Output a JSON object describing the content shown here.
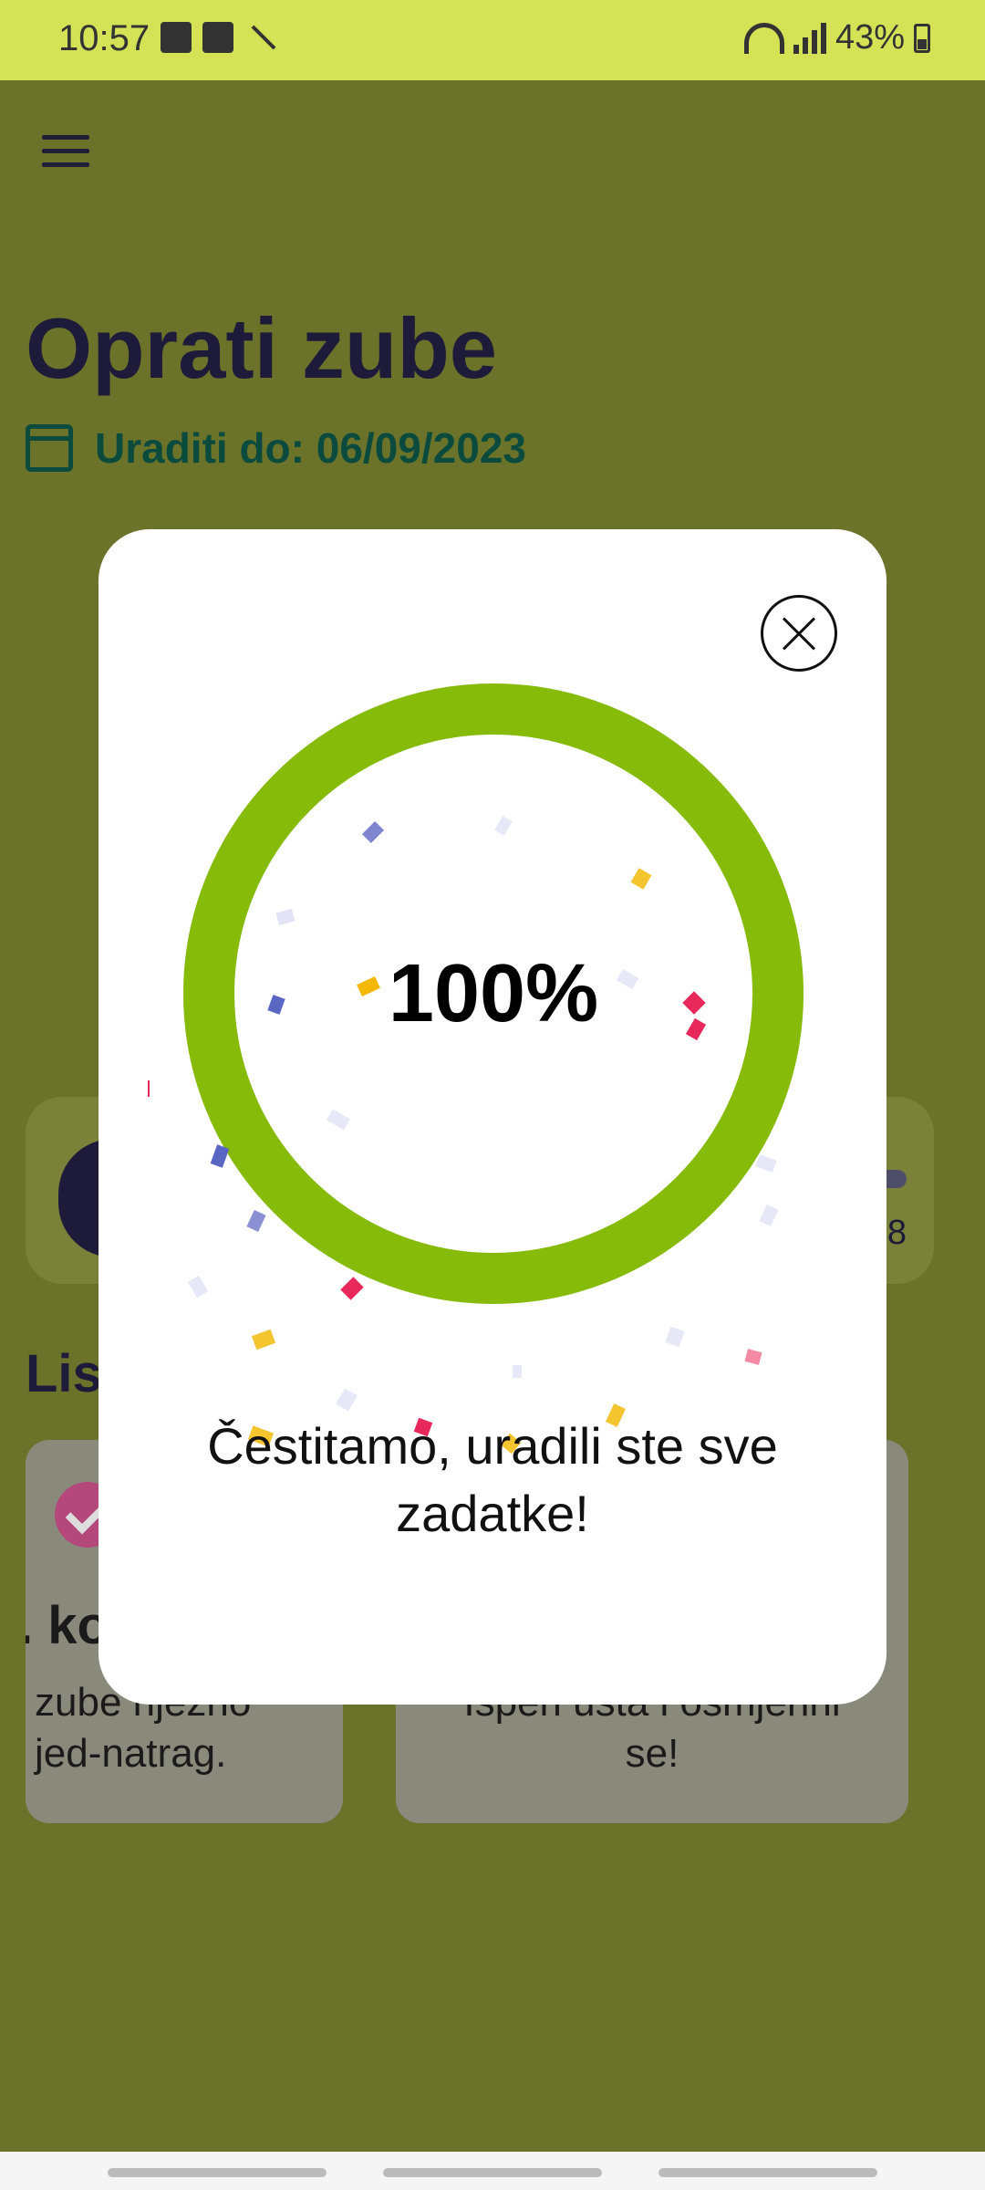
{
  "status_bar": {
    "time": "10:57",
    "battery_text": "43%",
    "icons": [
      "image-icon",
      "check-square-icon",
      "magic-wand-icon",
      "wifi-icon",
      "signal-icon",
      "battery-icon"
    ]
  },
  "header": {
    "menu_icon": "hamburger-menu-icon"
  },
  "task": {
    "title": "Oprati zube",
    "due_label": "Uraditi do: 06/09/2023"
  },
  "background": {
    "progress_count_fragment": "8",
    "list_heading_fragment": "Lis",
    "steps": [
      {
        "title_fragment": ". ko",
        "description": "zube njezno\njed-natrag."
      },
      {
        "title_fragment": "",
        "description": "Isperi usta i osmjehni\nse!"
      }
    ]
  },
  "modal": {
    "percent_label": "100%",
    "progress_fraction": 1.0,
    "message": "Čestitamo, uradili ste sve zadatke!",
    "close_icon": "close-circle-icon"
  },
  "colors": {
    "status_bar": "#d4e356",
    "dim_background": "#6b7229",
    "ring": "#86bb0a",
    "title": "#1e1a3a",
    "due_text": "#0b4b3e",
    "confetti": [
      "#f5b800",
      "#e8285a",
      "#5a66c4",
      "#dfe2f6",
      "#f7c8d6"
    ]
  }
}
